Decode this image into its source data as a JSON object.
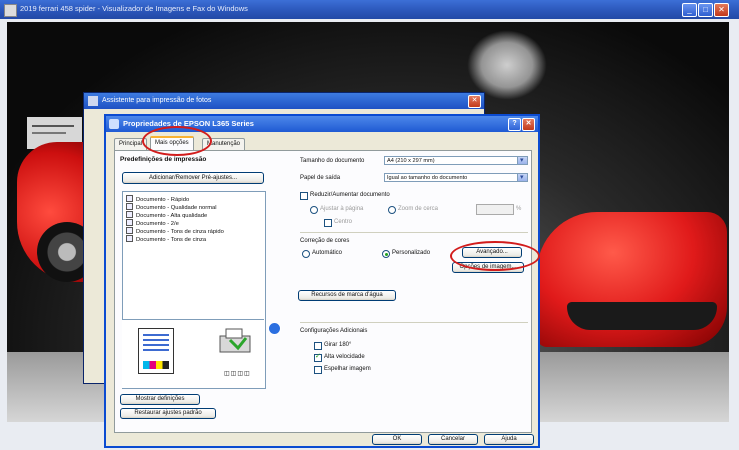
{
  "viewer": {
    "title": "2019 ferrari 458 spider - Visualizador de Imagens e Fax do Windows",
    "minimize": "_",
    "maximize": "□",
    "close": "✕"
  },
  "back_dialog": {
    "title": "Assistente para impressão de fotos",
    "close": "✕"
  },
  "dialog": {
    "title": "Propriedades de EPSON L365 Series",
    "help": "?",
    "close": "✕",
    "tabs": [
      "Principal",
      "Mais opções",
      "Manutenção"
    ],
    "presets_title": "Predefinições de impressão",
    "presets_button": "Adicionar/Remover Pré-ajustes...",
    "presets": [
      "Documento - Rápido",
      "Documento - Qualidade normal",
      "Documento - Alta qualidade",
      "Documento - 2/e",
      "Documento - Tons de cinza rápido",
      "Documento - Tons de cinza"
    ],
    "ink_levels": "◫◫◫◫",
    "show_settings": "Mostrar definições",
    "restore_defaults": "Restaurar ajustes padrão",
    "doc_size_label": "Tamanho do documento",
    "doc_size_value": "A4 (210 x 297 mm)",
    "output_paper_label": "Papel de saída",
    "output_paper_value": "Igual ao tamanho do documento",
    "reduce_enlarge": "Reduzir/Aumentar documento",
    "fit_page": "Ajustar à página",
    "zoom_to": "Zoom de cerca",
    "center": "Centro",
    "zoom_unit": "%",
    "color_correction_title": "Correção de cores",
    "auto": "Automático",
    "custom": "Personalizado",
    "advanced": "Avançado...",
    "image_options": "Opções de imagem...",
    "watermark": "Recursos de marca d'água",
    "extra_settings_title": "Configurações Adicionais",
    "rotate180": "Girar 180°",
    "high_speed": "Alta velocidade",
    "mirror": "Espelhar imagem",
    "ok": "OK",
    "cancel": "Cancelar",
    "help_btn": "Ajuda"
  },
  "colors": {
    "titlebar_blue": "#2249a6",
    "highlight_red": "#d21c1c",
    "dialog_bg": "#ece9d8"
  }
}
